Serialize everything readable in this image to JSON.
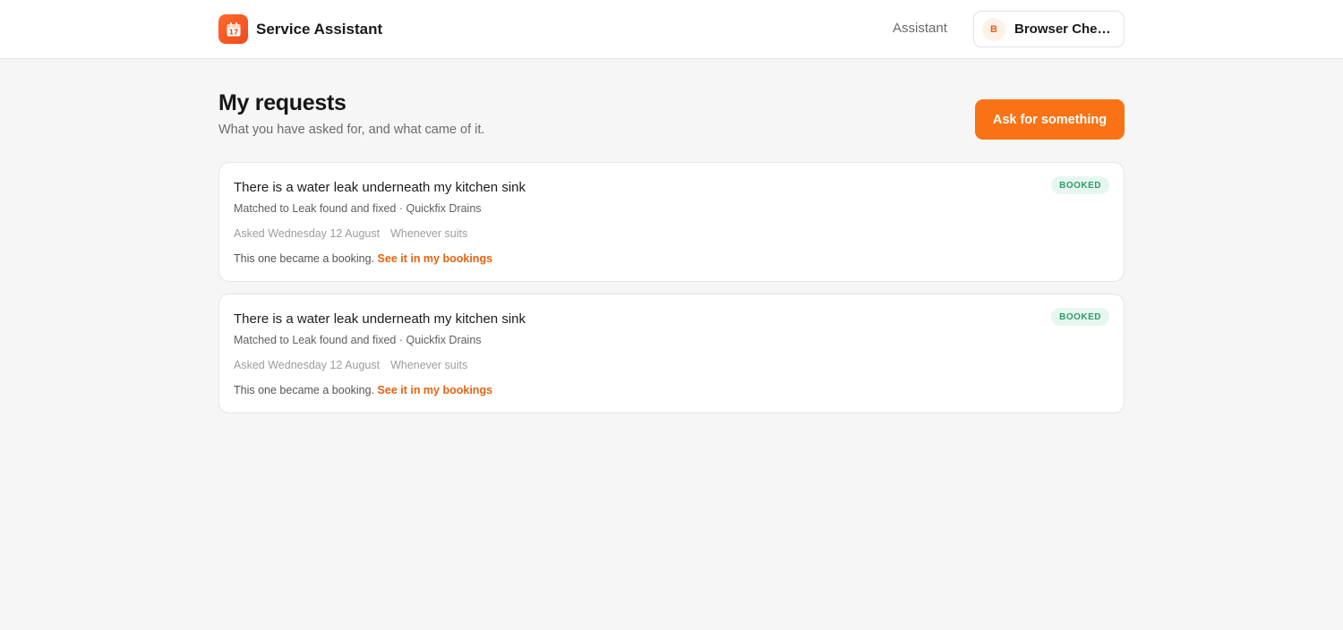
{
  "app": {
    "name": "Service Assistant",
    "logo_icon": "calendar-icon"
  },
  "nav": {
    "assistant_label": "Assistant"
  },
  "user": {
    "initial": "B",
    "name": "Browser Check..."
  },
  "page": {
    "title": "My requests",
    "subtitle": "What you have asked for, and what came of it.",
    "primary_action": "Ask for something"
  },
  "colors": {
    "accent": "#f97316",
    "badge_bg": "#e6f7ef",
    "badge_text": "#2f9a6a",
    "link": "#e8620f"
  },
  "requests": [
    {
      "title": "There is a water leak underneath my kitchen sink",
      "status": "BOOKED",
      "match": "Matched to Leak found and fixed · Quickfix Drains",
      "asked": "Asked Wednesday 12 August",
      "timing": "Whenever suits",
      "footer_text": "This one became a booking.",
      "footer_link": "See it in my bookings"
    },
    {
      "title": "There is a water leak underneath my kitchen sink",
      "status": "BOOKED",
      "match": "Matched to Leak found and fixed · Quickfix Drains",
      "asked": "Asked Wednesday 12 August",
      "timing": "Whenever suits",
      "footer_text": "This one became a booking.",
      "footer_link": "See it in my bookings"
    }
  ]
}
